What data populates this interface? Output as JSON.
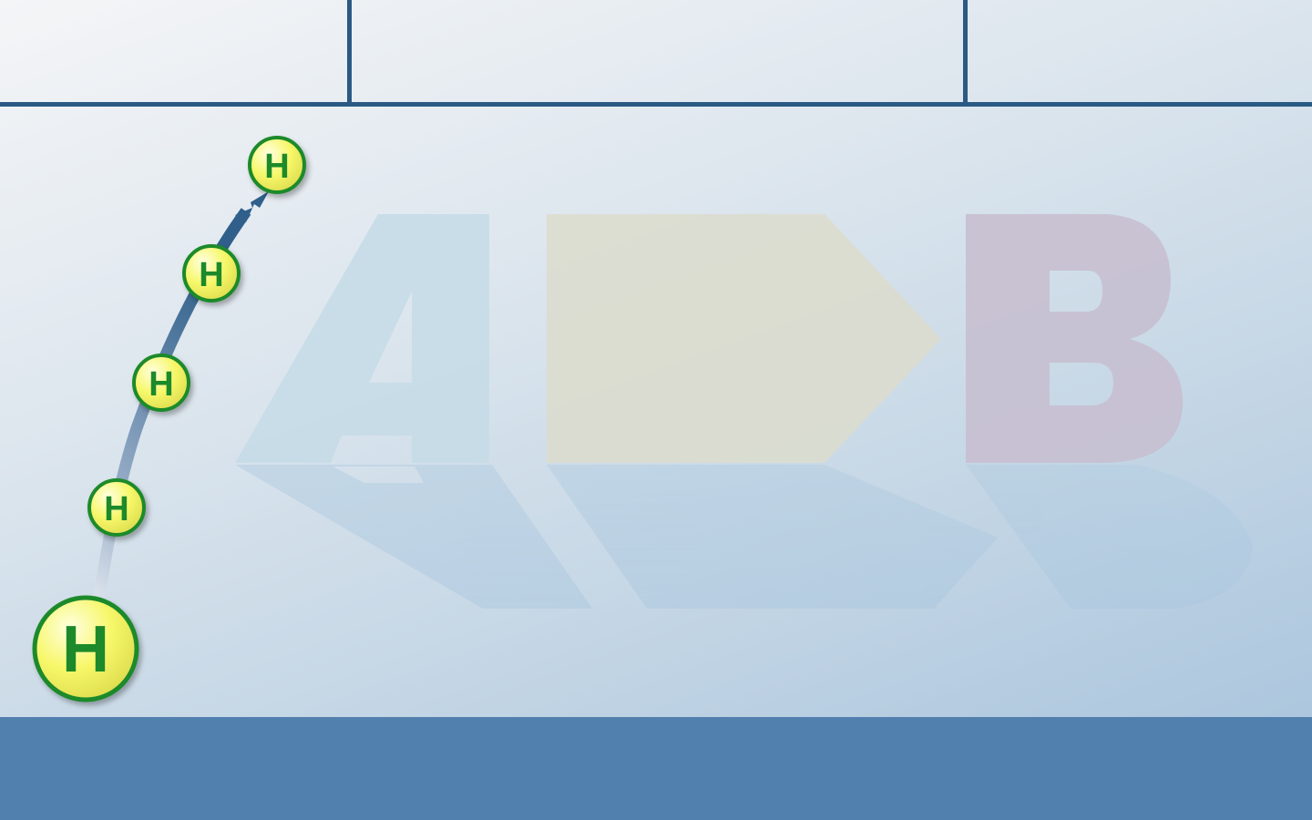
{
  "header": {
    "cells": [
      "",
      "",
      ""
    ]
  },
  "watermark": {
    "letter_a": "A",
    "letter_b": "B",
    "colors": {
      "a": "#c6dbe8",
      "arrow": "#dcdccc",
      "b": "#c7bfd0",
      "shadow": "#aec9de"
    }
  },
  "chain": {
    "atoms": [
      {
        "label": "H",
        "name": "hydrogen-atom-large"
      },
      {
        "label": "H",
        "name": "hydrogen-atom-2"
      },
      {
        "label": "H",
        "name": "hydrogen-atom-3"
      },
      {
        "label": "H",
        "name": "hydrogen-atom-4"
      },
      {
        "label": "H",
        "name": "hydrogen-atom-5"
      }
    ],
    "colors": {
      "atom_fill": "#f3f47a",
      "atom_ring": "#1f8a2a",
      "atom_text": "#1f8a2a",
      "path": "#2f5f8a"
    }
  },
  "footer": {
    "color": "#517fae"
  }
}
